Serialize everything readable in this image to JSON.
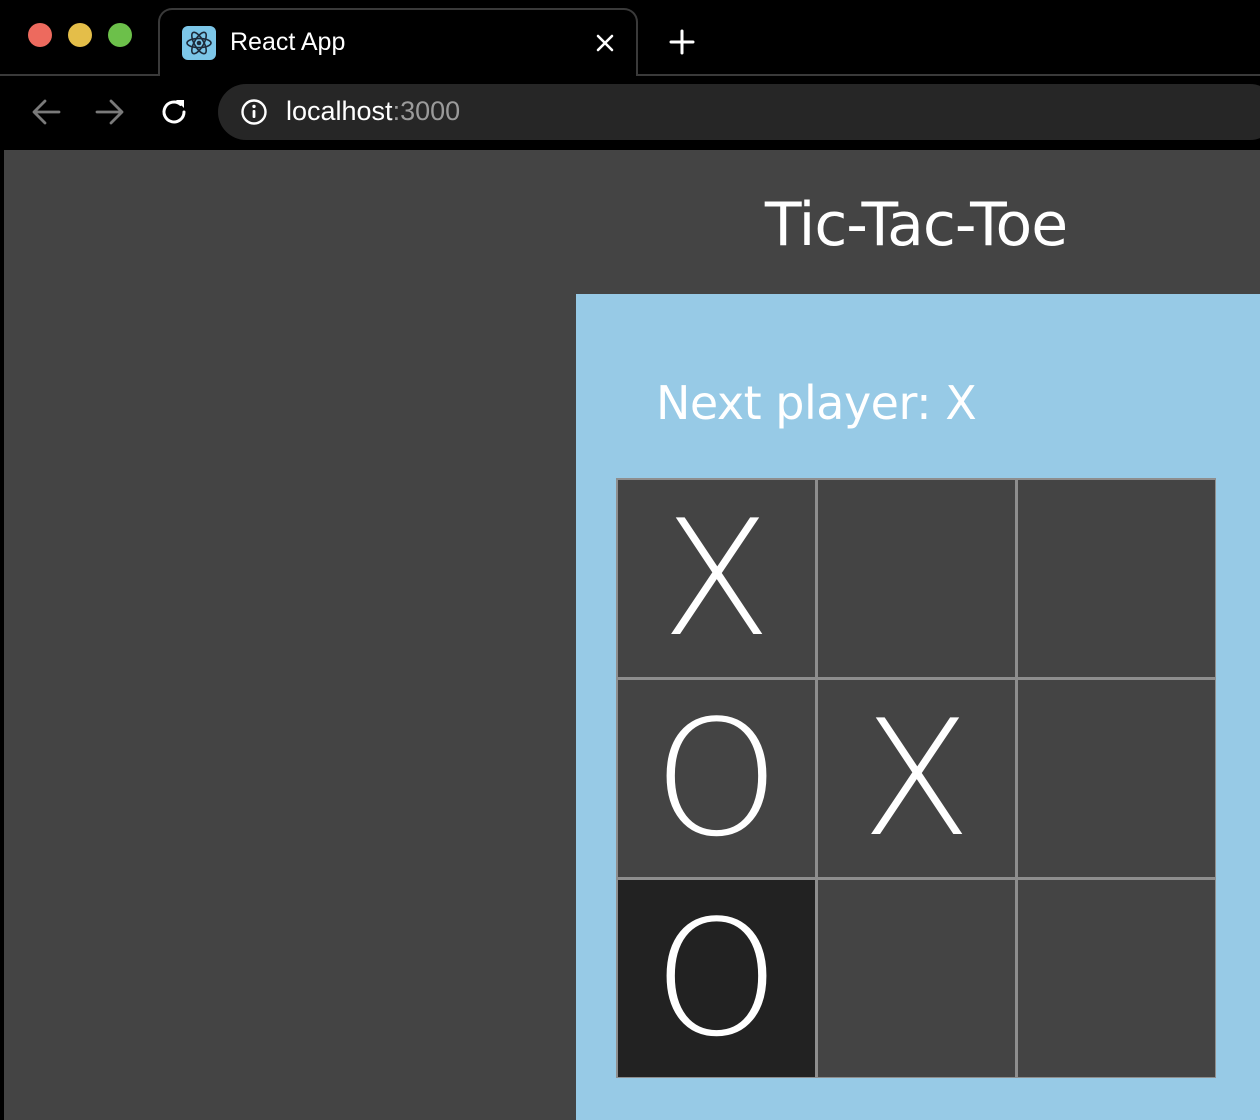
{
  "browser": {
    "tab_title": "React App",
    "url_host": "localhost",
    "url_port": ":3000"
  },
  "page": {
    "title": "Tic-Tac-Toe",
    "status": "Next player: X"
  },
  "board": {
    "squares": [
      "X",
      "",
      "",
      "O",
      "X",
      "",
      "O",
      "",
      ""
    ],
    "highlighted_square": 6
  },
  "colors": {
    "page_background": "#444444",
    "panel_background": "#97cae6",
    "square_background": "#444444",
    "highlighted_square": "#222222",
    "grid_lines": "#8e8e8e",
    "traffic_close": "#ed6a5e",
    "traffic_minimize": "#e4be49",
    "traffic_maximize": "#6cc04a"
  },
  "icons": {
    "tab_favicon": "react-logo-icon",
    "tab_close": "close-icon",
    "new_tab": "plus-icon",
    "back": "arrow-left-icon",
    "forward": "arrow-right-icon",
    "reload": "reload-icon",
    "site_info": "info-icon"
  }
}
